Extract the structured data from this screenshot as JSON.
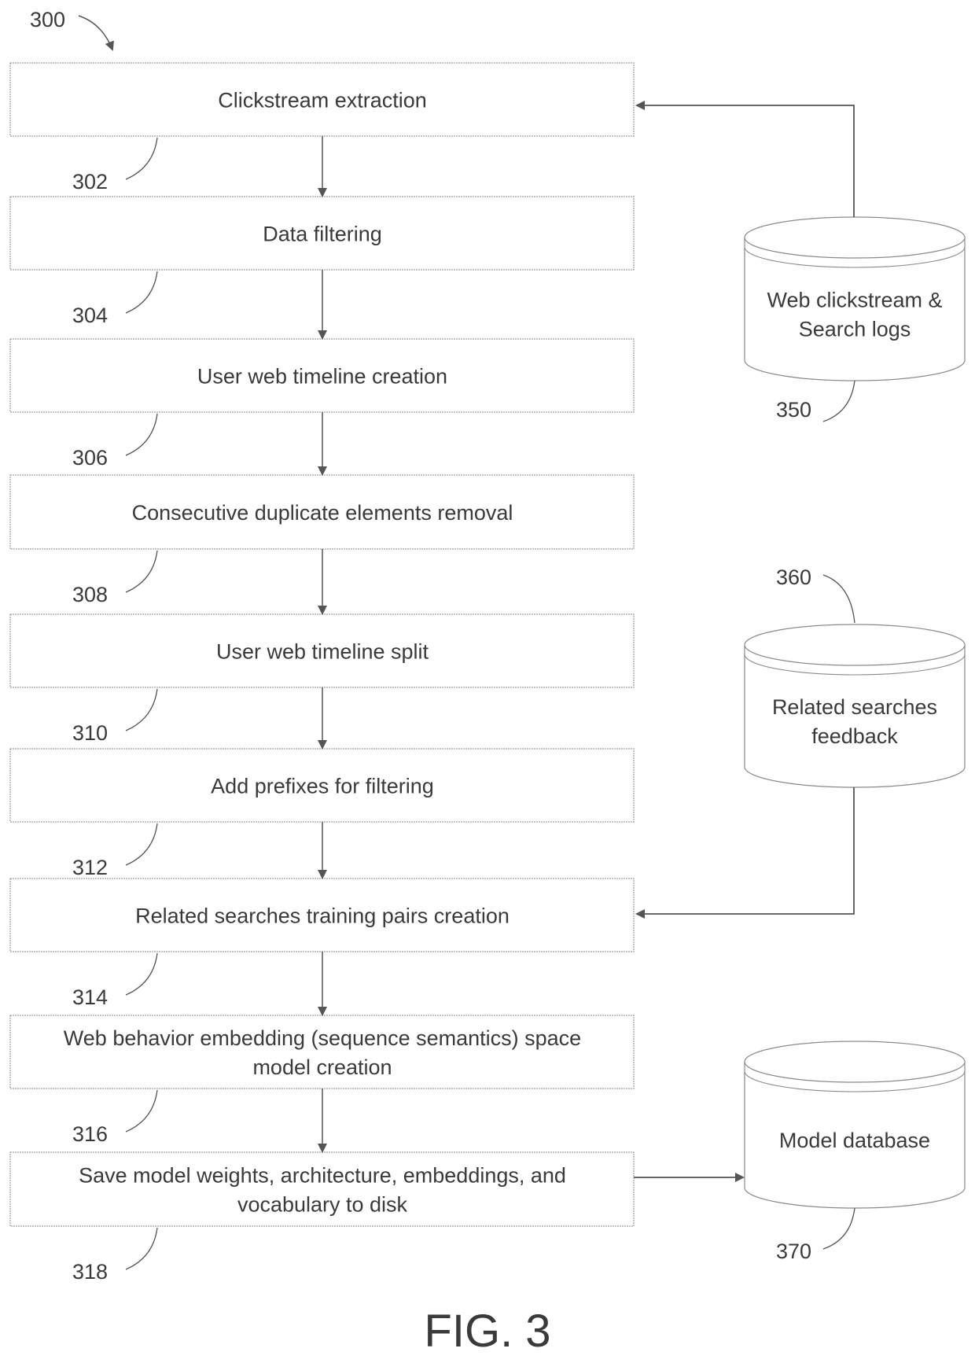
{
  "figure": {
    "id": "300",
    "caption": "FIG. 3"
  },
  "steps": [
    {
      "ref": "302",
      "lines": [
        "Clickstream extraction"
      ]
    },
    {
      "ref": "304",
      "lines": [
        "Data filtering"
      ]
    },
    {
      "ref": "306",
      "lines": [
        "User web timeline creation"
      ]
    },
    {
      "ref": "308",
      "lines": [
        "Consecutive duplicate elements removal"
      ]
    },
    {
      "ref": "310",
      "lines": [
        "User web timeline split"
      ]
    },
    {
      "ref": "312",
      "lines": [
        "Add prefixes for filtering"
      ]
    },
    {
      "ref": "314",
      "lines": [
        "Related searches training pairs creation"
      ]
    },
    {
      "ref": "316",
      "lines": [
        "Web behavior embedding (sequence semantics) space",
        "model creation"
      ]
    },
    {
      "ref": "318",
      "lines": [
        "Save model weights, architecture, embeddings, and",
        "vocabulary to disk"
      ]
    }
  ],
  "databases": [
    {
      "ref": "350",
      "lines": [
        "Web clickstream &",
        "Search logs"
      ],
      "connects_to_step": "302",
      "direction": "to-step"
    },
    {
      "ref": "360",
      "lines": [
        "Related searches",
        "feedback"
      ],
      "connects_to_step": "314",
      "direction": "to-step"
    },
    {
      "ref": "370",
      "lines": [
        "Model database"
      ],
      "connects_to_step": "318",
      "direction": "from-step"
    }
  ],
  "colors": {
    "stroke": "#555555",
    "box_border": "#8a8a8a",
    "text": "#3a3a3a"
  }
}
